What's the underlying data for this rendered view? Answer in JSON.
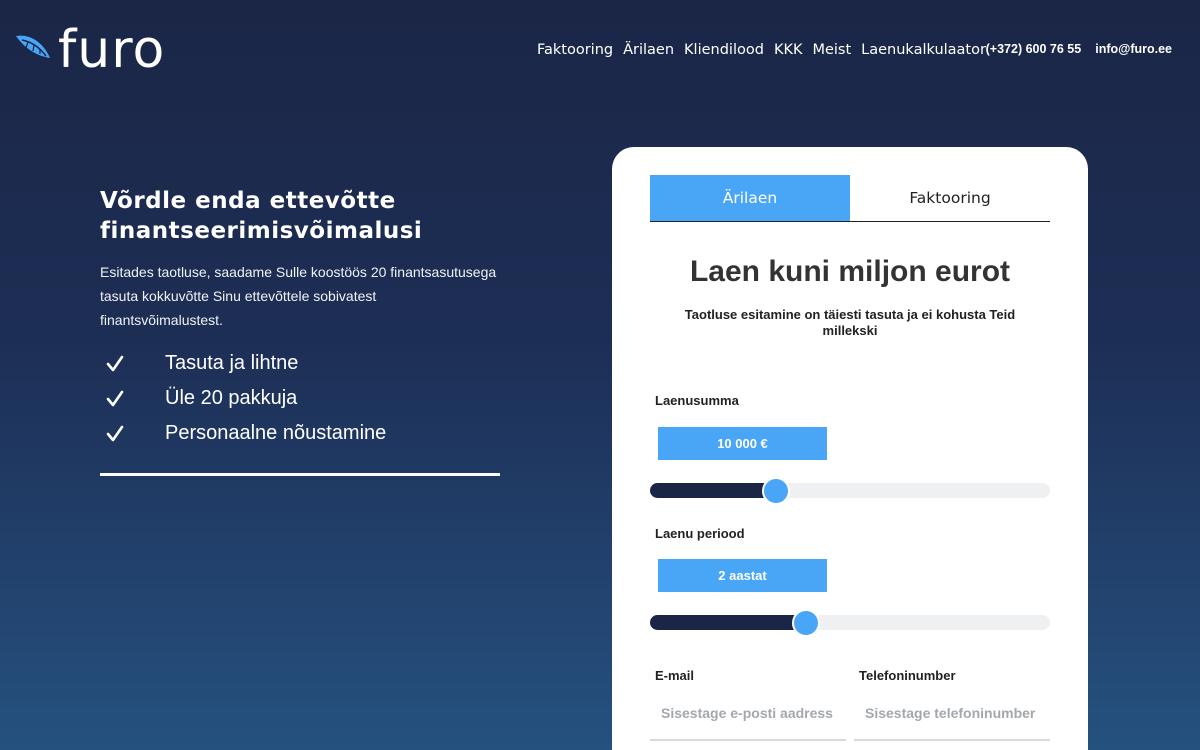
{
  "header": {
    "logo_text": "furo",
    "nav": [
      "Faktooring",
      "Ärilaen",
      "Kliendilood",
      "KKK",
      "Meist",
      "Laenukalkulaator"
    ],
    "phone": "(+372) 600 76 55",
    "email": "info@furo.ee"
  },
  "hero": {
    "title_line1": "Võrdle enda ettevõtte",
    "title_line2": "finantseerimisvõimalusi",
    "description": "Esitades taotluse, saadame Sulle koostöös 20 finantsasutusega tasuta kokkuvõtte Sinu ettevõttele sobivatest finantsvõimalustest.",
    "features": [
      "Tasuta ja lihtne",
      "Üle 20 pakkuja",
      "Personaalne nõustamine"
    ]
  },
  "form": {
    "tabs": [
      {
        "label": "Ärilaen",
        "active": true
      },
      {
        "label": "Faktooring",
        "active": false
      }
    ],
    "title": "Laen kuni miljon eurot",
    "subtitle": "Taotluse esitamine on täiesti tasuta ja ei kohusta Teid millekski",
    "amount": {
      "label": "Laenusumma",
      "value": "10 000 €",
      "fraction": 0.315
    },
    "period": {
      "label": "Laenu periood",
      "value": "2 aastat",
      "fraction": 0.39
    },
    "email": {
      "label": "E-mail",
      "placeholder": "Sisestage e-posti aadress"
    },
    "phone": {
      "label": "Telefoninumber",
      "placeholder": "Sisestage telefoninumber"
    }
  },
  "colors": {
    "accent": "#49a5f5",
    "navy": "#1b2646"
  }
}
